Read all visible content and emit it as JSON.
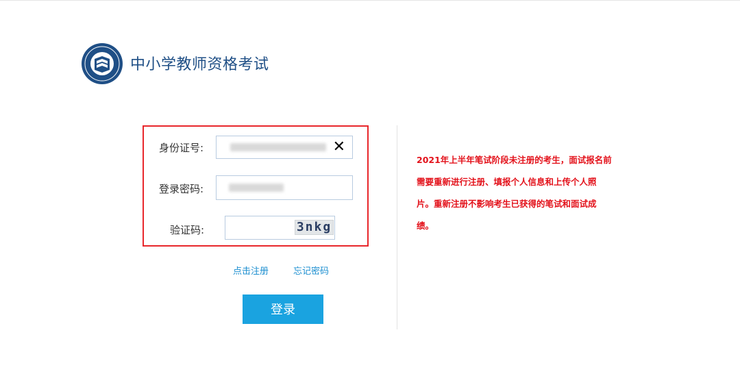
{
  "header": {
    "logo_icon": "exam-emblem-icon",
    "title": "中小学教师资格考试"
  },
  "form": {
    "id_label": "身份证号:",
    "password_label": "登录密码:",
    "captcha_label": "验证码:",
    "captcha_text": "3nkg",
    "clear_icon": "close-icon",
    "highlight_color": "#e8262b"
  },
  "links": {
    "register": "点击注册",
    "forgot": "忘记密码"
  },
  "buttons": {
    "login": "登录",
    "login_color": "#1aa3e0"
  },
  "notice": {
    "text": "2021年上半年笔试阶段未注册的考生，面试报名前需要重新进行注册、填报个人信息和上传个人照片。重新注册不影响考生已获得的笔试和面试成绩。",
    "color": "#e3121b"
  }
}
